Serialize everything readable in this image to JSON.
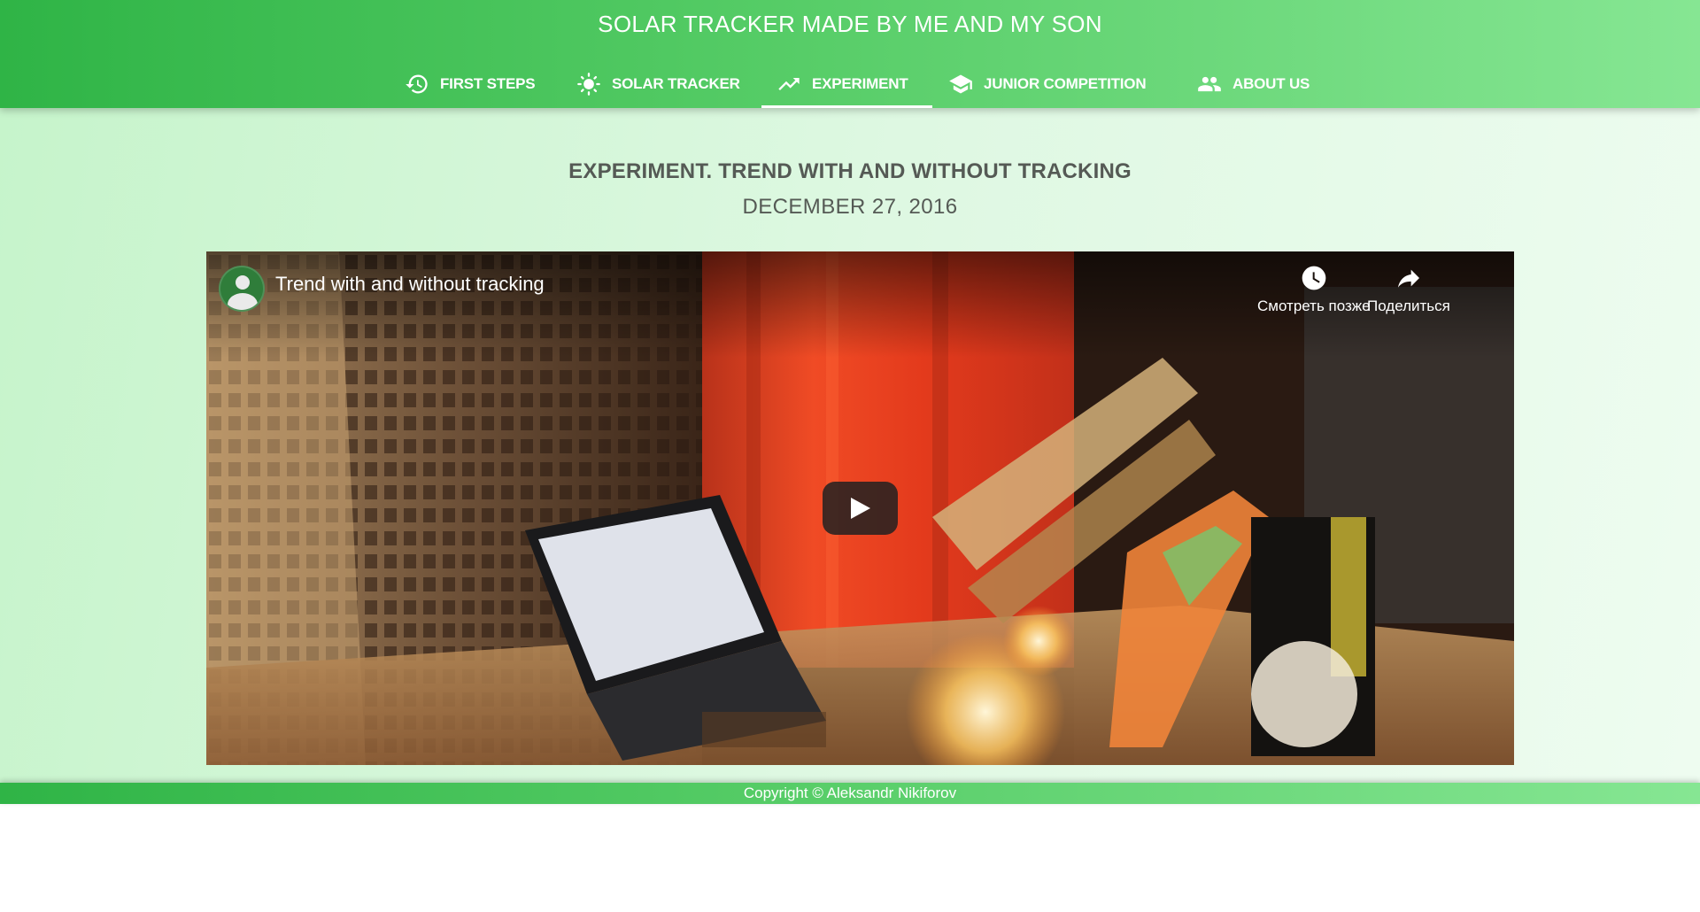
{
  "site": {
    "title": "SOLAR TRACKER MADE BY ME AND MY SON"
  },
  "nav": {
    "items": [
      {
        "label": "FIRST STEPS",
        "icon": "history-icon",
        "active": false
      },
      {
        "label": "SOLAR TRACKER",
        "icon": "sun-icon",
        "active": false
      },
      {
        "label": "EXPERIMENT",
        "icon": "trending-up-icon",
        "active": true
      },
      {
        "label": "JUNIOR COMPETITION",
        "icon": "graduation-cap-icon",
        "active": false
      },
      {
        "label": "ABOUT US",
        "icon": "group-icon",
        "active": false
      }
    ]
  },
  "post": {
    "title": "EXPERIMENT. TREND WITH AND WITHOUT TRACKING",
    "date": "DECEMBER 27, 2016"
  },
  "video": {
    "title": "Trend with and without tracking",
    "watch_later_label": "Смотреть позже",
    "share_label": "Поделиться",
    "icons": [
      "channel-avatar",
      "clock-icon",
      "share-icon",
      "play-icon"
    ]
  },
  "footer": {
    "copyright": "Copyright © Aleksandr Nikiforov"
  },
  "colors": {
    "header_gradient_start": "#2fb446",
    "header_gradient_end": "#86e693",
    "content_background": "#d8f7dc",
    "text_muted": "#555a55",
    "player_button": "#212121"
  }
}
